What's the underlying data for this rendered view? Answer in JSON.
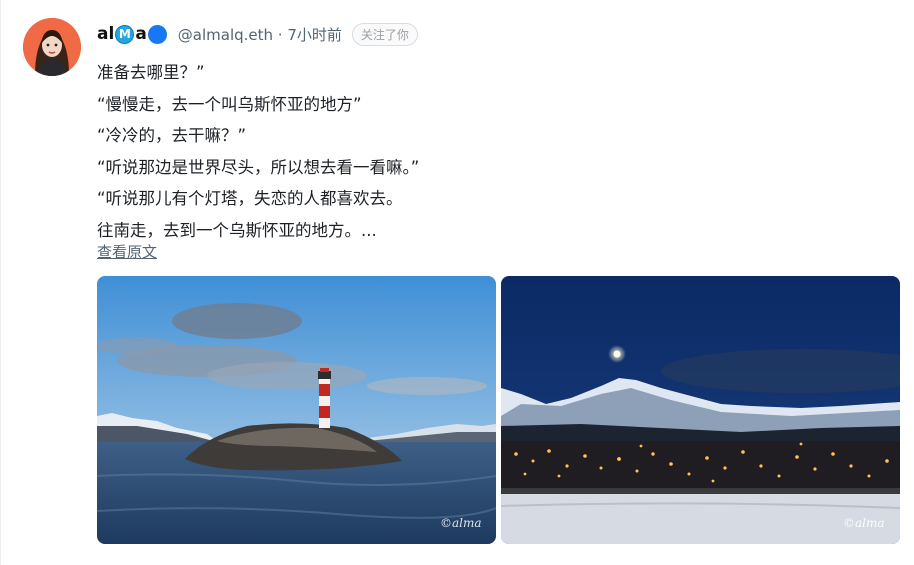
{
  "author": {
    "name_prefix": "al",
    "badge_letter": "M",
    "name_middle": "a",
    "handle_time": "@almalq.eth · 7小时前",
    "follow_label": "关注了你"
  },
  "post": {
    "lines": [
      "准备去哪里？”",
      "“慢慢走，去一个叫乌斯怀亚的地方”",
      "“冷冷的，去干嘛？”",
      "“听说那边是世界尽头，所以想去看一看嘛。”",
      "“听说那儿有个灯塔，失恋的人都喜欢去。",
      "往南走，去到一个乌斯怀亚的地方。..."
    ],
    "show_original": "查看原文"
  },
  "photos": [
    {
      "watermark": "©alma"
    },
    {
      "watermark": "©alma"
    }
  ],
  "colors": {
    "accent": "#1877f2",
    "badge": "#22a6e6"
  }
}
